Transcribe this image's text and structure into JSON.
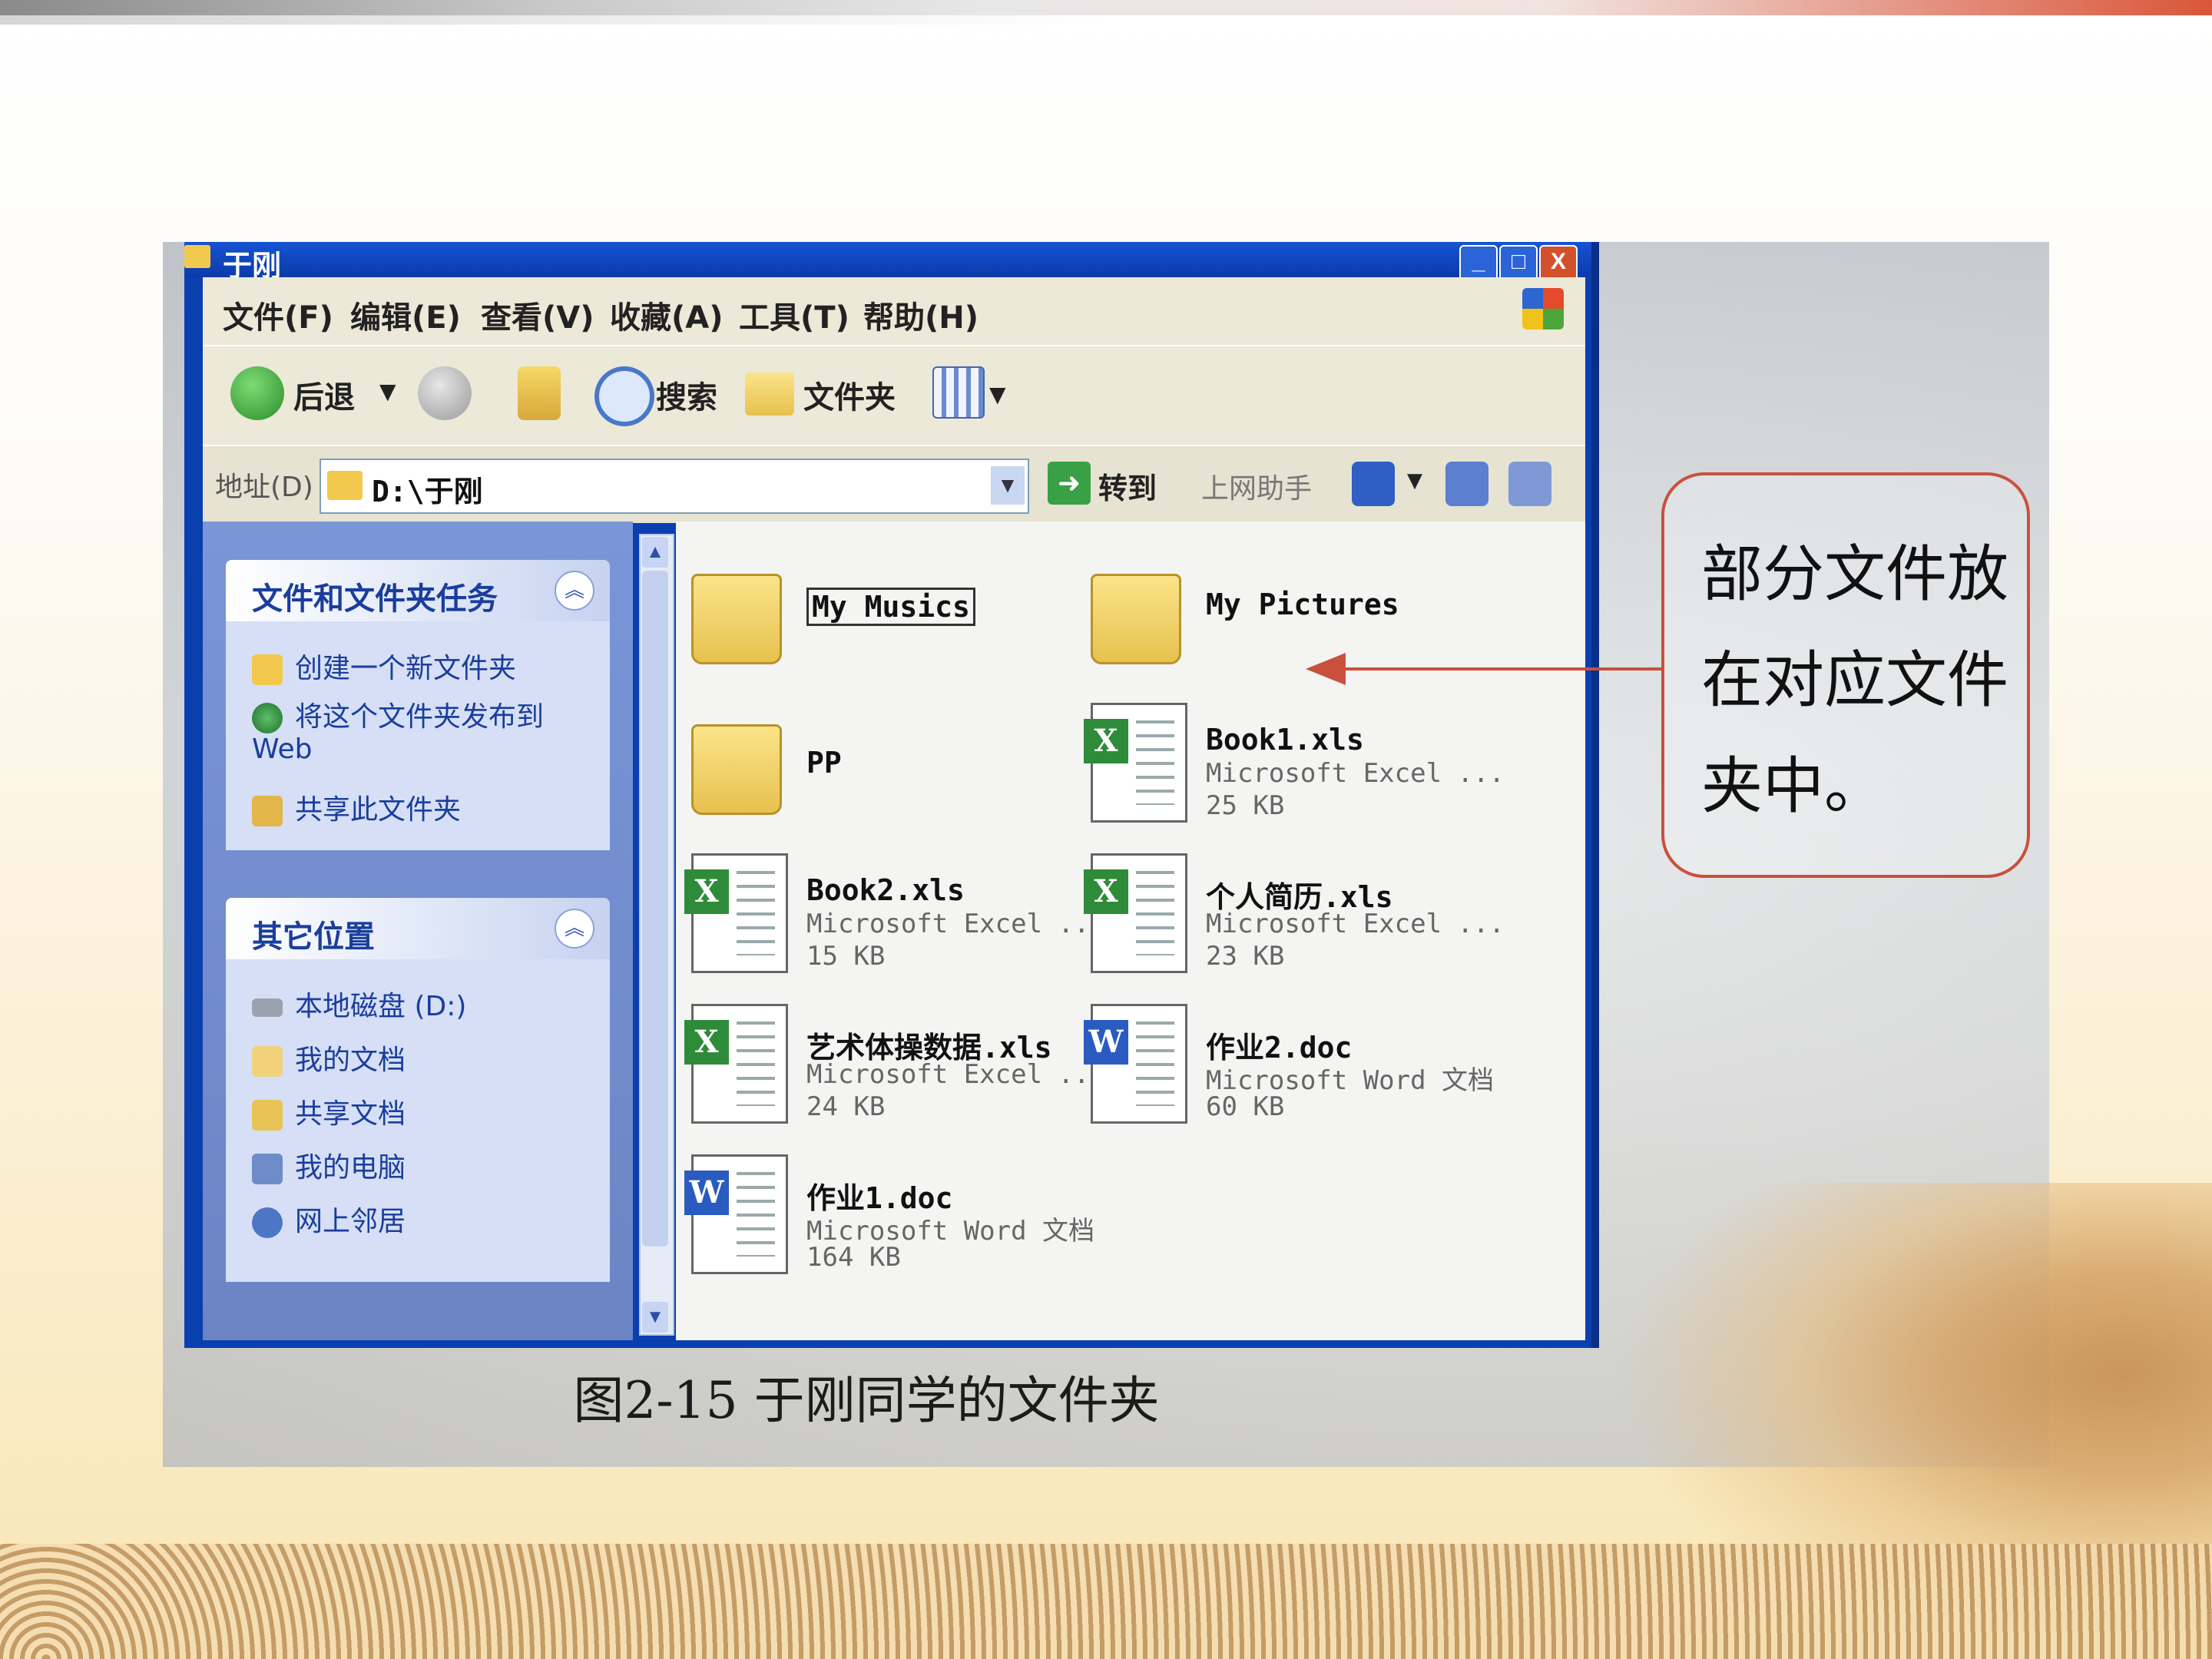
{
  "window": {
    "title": "于刚",
    "min_glyph": "_",
    "max_glyph": "□",
    "close_glyph": "X"
  },
  "menu": [
    "文件(F)",
    "编辑(E)",
    "查看(V)",
    "收藏(A)",
    "工具(T)",
    "帮助(H)"
  ],
  "toolbar": {
    "back_label": "后退",
    "search_label": "搜索",
    "folders_label": "文件夹"
  },
  "address": {
    "label": "地址(D)",
    "value": "D:\\于刚",
    "go_label": "转到",
    "assistant_label": "上网助手"
  },
  "tasks_panel": {
    "title": "文件和文件夹任务",
    "items": [
      "创建一个新文件夹",
      "将这个文件夹发布到Web",
      "共享此文件夹"
    ]
  },
  "places_panel": {
    "title": "其它位置",
    "items": [
      "本地磁盘 (D:)",
      "我的文档",
      "共享文档",
      "我的电脑",
      "网上邻居"
    ]
  },
  "files": [
    {
      "name": "My Musics",
      "type": "",
      "size": "",
      "icon": "folder-icon"
    },
    {
      "name": "My Pictures",
      "type": "",
      "size": "",
      "icon": "folder-icon"
    },
    {
      "name": "PP",
      "type": "",
      "size": "",
      "icon": "folder-icon"
    },
    {
      "name": "Book1.xls",
      "type": "Microsoft Excel ...",
      "size": "25 KB",
      "icon": "excel-file-icon"
    },
    {
      "name": "Book2.xls",
      "type": "Microsoft Excel ...",
      "size": "15 KB",
      "icon": "excel-file-icon"
    },
    {
      "name": "个人简历.xls",
      "type": "Microsoft Excel ...",
      "size": "23 KB",
      "icon": "excel-file-icon"
    },
    {
      "name": "艺术体操数据.xls",
      "type": "Microsoft Excel ...",
      "size": "24 KB",
      "icon": "excel-file-icon"
    },
    {
      "name": "作业2.doc",
      "type": "Microsoft Word 文档",
      "size": "60 KB",
      "icon": "word-file-icon"
    },
    {
      "name": "作业1.doc",
      "type": "Microsoft Word 文档",
      "size": "164 KB",
      "icon": "word-file-icon"
    }
  ],
  "caption": "图2-15 于刚同学的文件夹",
  "callout": "部分文件放在对应文件夹中。",
  "colors": {
    "callout_border": "#c9503d",
    "excel_green": "#2e8b3a",
    "word_blue": "#2a5bc0",
    "xp_blue": "#0a3fb0"
  }
}
